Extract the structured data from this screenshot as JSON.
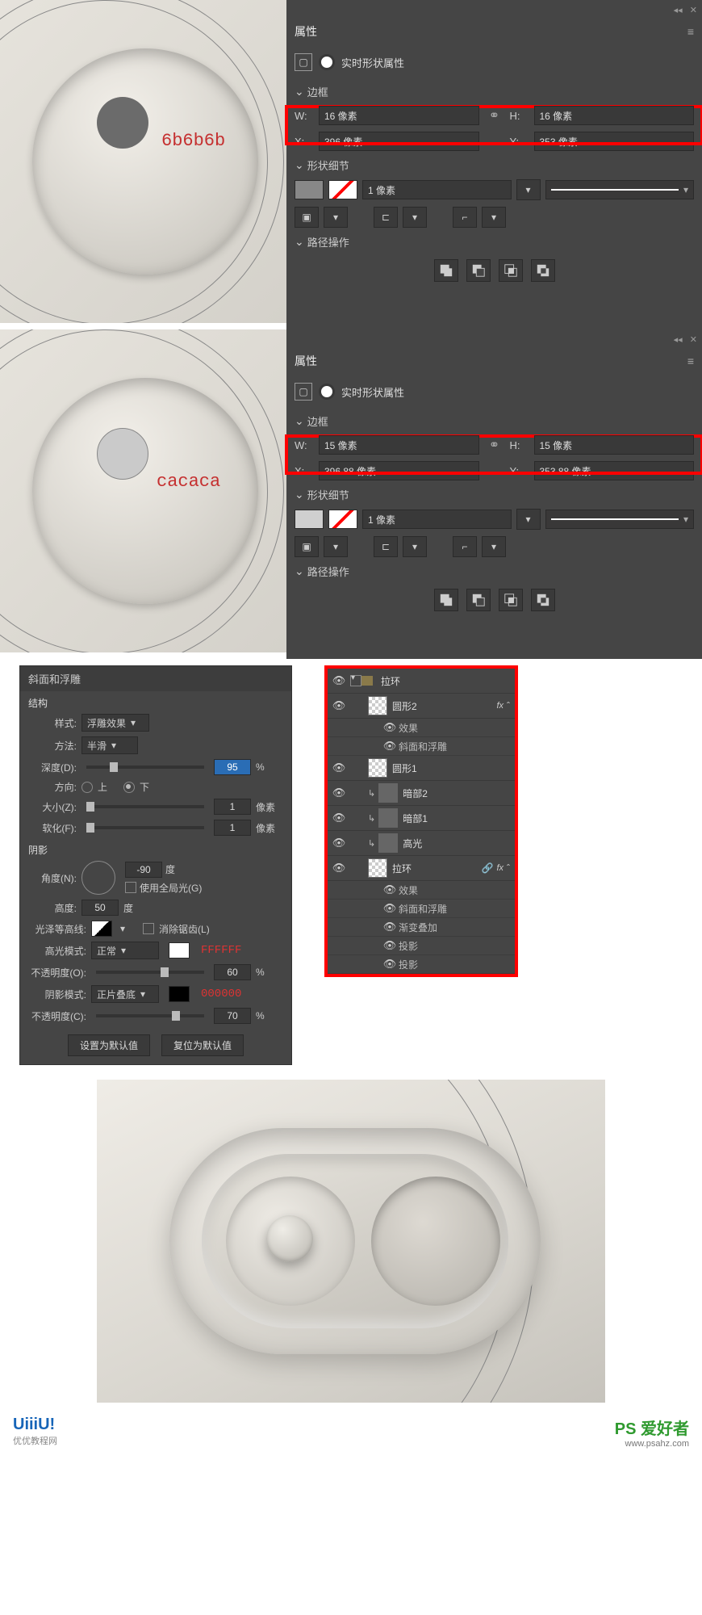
{
  "panel1": {
    "canvas_label": "6b6b6b",
    "panel_title": "属性",
    "icon_label": "实时形状属性",
    "sections": {
      "box": "边框",
      "detail": "形状细节",
      "path": "路径操作"
    },
    "w_lbl": "W:",
    "w_val": "16 像素",
    "h_lbl": "H:",
    "h_val": "16 像素",
    "x_lbl": "X:",
    "x_val": "396 像素",
    "y_lbl": "Y:",
    "y_val": "353 像素",
    "stroke_val": "1 像素"
  },
  "panel2": {
    "canvas_label": "cacaca",
    "panel_title": "属性",
    "icon_label": "实时形状属性",
    "sections": {
      "box": "边框",
      "detail": "形状细节",
      "path": "路径操作"
    },
    "w_lbl": "W:",
    "w_val": "15 像素",
    "h_lbl": "H:",
    "h_val": "15 像素",
    "x_lbl": "X:",
    "x_val": "396.88 像素",
    "y_lbl": "Y:",
    "y_val": "353.88 像素",
    "stroke_val": "1 像素"
  },
  "bevel": {
    "title": "斜面和浮雕",
    "struct": "结构",
    "style_lbl": "样式:",
    "style_val": "浮雕效果",
    "method_lbl": "方法:",
    "method_val": "半滑",
    "depth_lbl": "深度(D):",
    "depth_val": "95",
    "pct": "%",
    "dir_lbl": "方向:",
    "up": "上",
    "down": "下",
    "size_lbl": "大小(Z):",
    "size_val": "1",
    "px": "像素",
    "soft_lbl": "软化(F):",
    "soft_val": "1",
    "shadow": "阴影",
    "ang_lbl": "角度(N):",
    "ang_val": "-90",
    "deg": "度",
    "global": "使用全局光(G)",
    "alt_lbl": "高度:",
    "alt_val": "50",
    "gloss_lbl": "光泽等高线:",
    "anti": "消除锯齿(L)",
    "hi_mode_lbl": "高光模式:",
    "hi_mode_val": "正常",
    "hi_color": "FFFFFF",
    "hi_op_lbl": "不透明度(O):",
    "hi_op_val": "60",
    "sh_mode_lbl": "阴影模式:",
    "sh_mode_val": "正片叠底",
    "sh_color": "000000",
    "sh_op_lbl": "不透明度(C):",
    "sh_op_val": "70",
    "btn_default": "设置为默认值",
    "btn_reset": "复位为默认值"
  },
  "layers": {
    "group": "拉环",
    "l1": "圆形2",
    "l1_fx": "效果",
    "l1_e1": "斜面和浮雕",
    "l2": "圆形1",
    "l3": "暗部2",
    "l4": "暗部1",
    "l5": "高光",
    "l6": "拉环",
    "l6_fx": "效果",
    "l6_e1": "斜面和浮雕",
    "l6_e2": "渐变叠加",
    "l6_e3": "投影",
    "l6_e4": "投影",
    "fx": "fx"
  },
  "wm": {
    "left_t": "UiiiU!",
    "left_s": "优优教程网",
    "right_t": "PS 爱好者",
    "right_s": "www.psahz.com"
  }
}
